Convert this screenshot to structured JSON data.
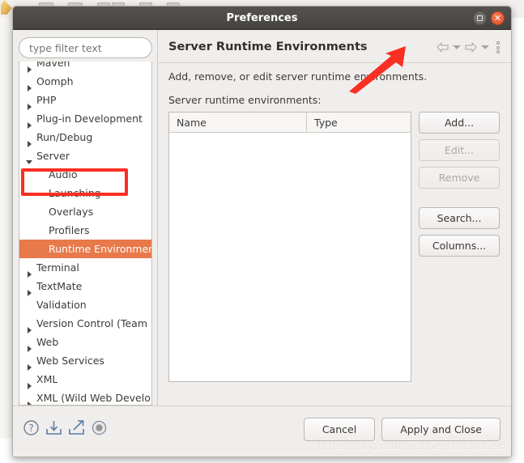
{
  "window": {
    "title": "Preferences",
    "maximize_icon": "maximize-icon",
    "close_icon": "close-icon"
  },
  "sidebar": {
    "filter": {
      "placeholder": "type filter text",
      "value": ""
    },
    "items": [
      {
        "label": "Maven",
        "arrow": "closed",
        "level": 0,
        "clipped": true
      },
      {
        "label": "Oomph",
        "arrow": "closed",
        "level": 0
      },
      {
        "label": "PHP",
        "arrow": "closed",
        "level": 0
      },
      {
        "label": "Plug-in Development",
        "arrow": "closed",
        "level": 0
      },
      {
        "label": "Run/Debug",
        "arrow": "closed",
        "level": 0
      },
      {
        "label": "Server",
        "arrow": "open",
        "level": 0,
        "annotated": true
      },
      {
        "label": "Audio",
        "arrow": "none",
        "level": 1
      },
      {
        "label": "Launching",
        "arrow": "none",
        "level": 1
      },
      {
        "label": "Overlays",
        "arrow": "none",
        "level": 1
      },
      {
        "label": "Profilers",
        "arrow": "none",
        "level": 1
      },
      {
        "label": "Runtime Environment",
        "arrow": "none",
        "level": 1,
        "selected": true
      },
      {
        "label": "Terminal",
        "arrow": "closed",
        "level": 0
      },
      {
        "label": "TextMate",
        "arrow": "closed",
        "level": 0
      },
      {
        "label": "Validation",
        "arrow": "none",
        "level": 0
      },
      {
        "label": "Version Control (Team",
        "arrow": "closed",
        "level": 0
      },
      {
        "label": "Web",
        "arrow": "closed",
        "level": 0
      },
      {
        "label": "Web Services",
        "arrow": "closed",
        "level": 0
      },
      {
        "label": "XML",
        "arrow": "closed",
        "level": 0
      },
      {
        "label": "XML (Wild Web Develo",
        "arrow": "closed",
        "level": 0
      }
    ]
  },
  "page": {
    "title": "Server Runtime Environments",
    "description": "Add, remove, or edit server runtime environments.",
    "table_label": "Server runtime environments:",
    "nav": {
      "back_icon": "back-arrow-icon",
      "back_caret_icon": "chevron-down-icon",
      "forward_icon": "forward-arrow-icon",
      "forward_caret_icon": "chevron-down-icon",
      "menu_icon": "vertical-dots-icon"
    },
    "table": {
      "columns": [
        "Name",
        "Type"
      ],
      "rows": []
    },
    "buttons": [
      {
        "label": "Add...",
        "enabled": true
      },
      {
        "label": "Edit...",
        "enabled": false
      },
      {
        "label": "Remove",
        "enabled": false
      },
      {
        "label": "Search...",
        "enabled": true
      },
      {
        "label": "Columns...",
        "enabled": true
      }
    ]
  },
  "footer": {
    "icons": [
      {
        "name": "help-icon"
      },
      {
        "name": "import-icon"
      },
      {
        "name": "export-icon"
      },
      {
        "name": "record-icon"
      }
    ],
    "cancel_label": "Cancel",
    "apply_label": "Apply and Close"
  },
  "watermark": "https://blog.csdn.net/bearcat303295",
  "colors": {
    "selection": "#e8794a",
    "annotation": "#f92f23",
    "titlebar": "#4a4845",
    "close_button": "#e0522b"
  }
}
